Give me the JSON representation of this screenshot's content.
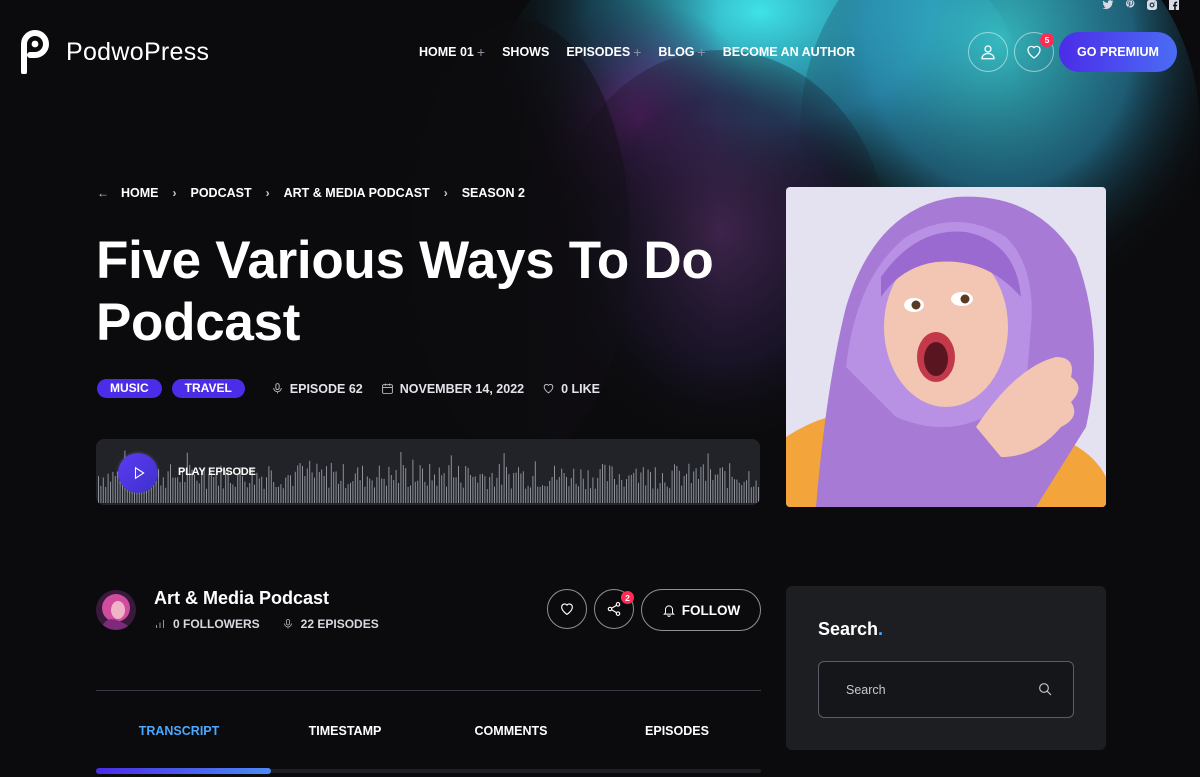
{
  "brand": {
    "name": "PodwoPress"
  },
  "social": [
    "twitter-icon",
    "pinterest-icon",
    "instagram-icon",
    "facebook-icon"
  ],
  "nav": {
    "items": [
      {
        "label": "HOME 01",
        "has_submenu": true
      },
      {
        "label": "SHOWS",
        "has_submenu": false
      },
      {
        "label": "EPISODES",
        "has_submenu": true
      },
      {
        "label": "BLOG",
        "has_submenu": true
      },
      {
        "label": "BECOME AN AUTHOR",
        "has_submenu": false
      }
    ],
    "plus": "+"
  },
  "header": {
    "wishlist_count": "5",
    "premium_label": "GO PREMIUM"
  },
  "breadcrumb": {
    "back": "←",
    "sep": "›",
    "items": [
      "HOME",
      "PODCAST",
      "ART & MEDIA PODCAST",
      "SEASON 2"
    ]
  },
  "episode": {
    "title": "Five Various Ways To Do Podcast",
    "tags": [
      "MUSIC",
      "TRAVEL"
    ],
    "episode_label": "EPISODE 62",
    "date": "NOVEMBER 14, 2022",
    "likes": "0 LIKE",
    "play_label": "PLAY EPISODE"
  },
  "podcast": {
    "name": "Art & Media Podcast",
    "followers": "0 FOLLOWERS",
    "episodes": "22 EPISODES",
    "share_count": "2",
    "follow_label": "FOLLOW"
  },
  "tabs": [
    "TRANSCRIPT",
    "TIMESTAMP",
    "COMMENTS",
    "EPISODES"
  ],
  "active_tab": 0,
  "sidebar": {
    "search_title": "Search",
    "search_dot": ".",
    "search_placeholder": "Search"
  },
  "colors": {
    "accent": "#4b2ce8",
    "link": "#4aa8ff",
    "badge": "#ff2b55"
  }
}
